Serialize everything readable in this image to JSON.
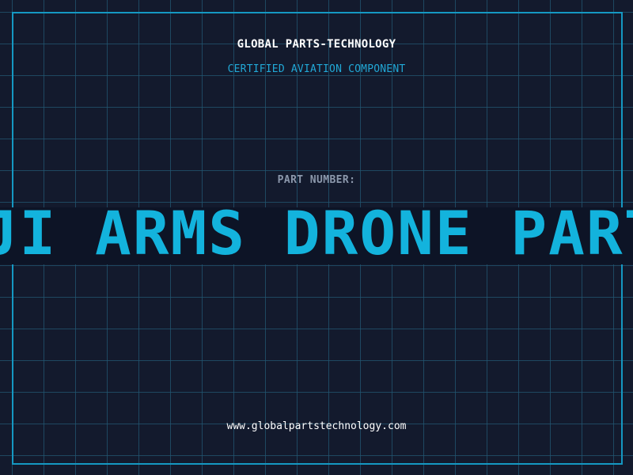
{
  "header": {
    "company": "GLOBAL PARTS-TECHNOLOGY",
    "subtitle": "CERTIFIED AVIATION COMPONENT"
  },
  "main": {
    "label": "PART NUMBER:",
    "part_number": "DJI ARMS DRONE PART LOCATION"
  },
  "footer": {
    "website": "www.globalpartstechnology.com"
  },
  "colors": {
    "background": "#131a2d",
    "grid": "#215673",
    "frame": "#1598c2",
    "accent": "#13b3dd",
    "label": "#8c98ac"
  }
}
